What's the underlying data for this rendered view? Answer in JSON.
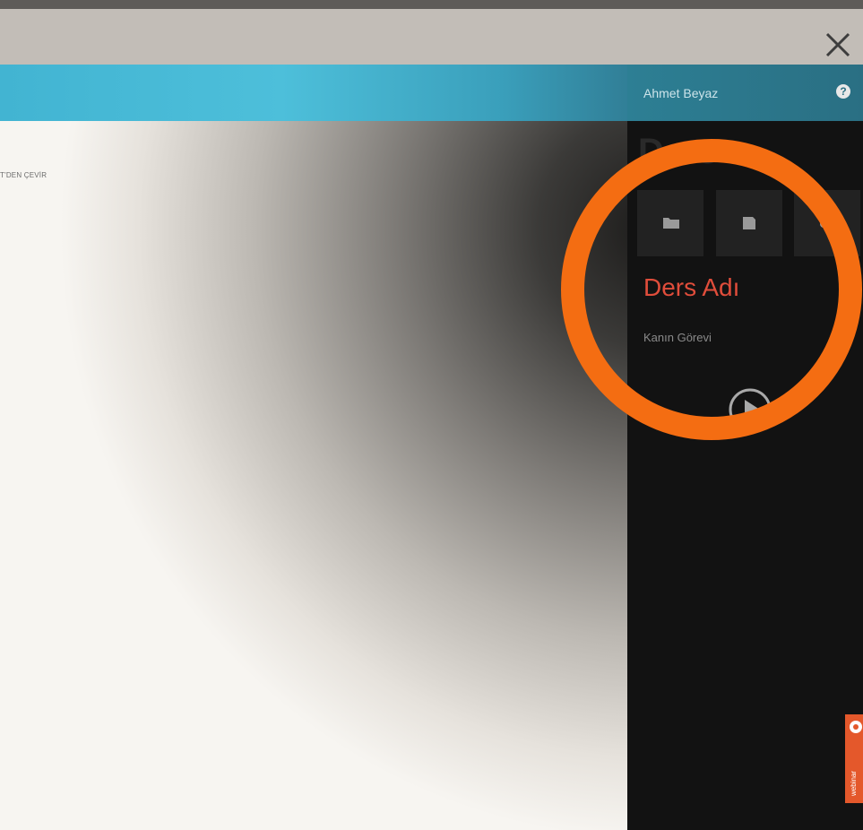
{
  "canvas": {
    "text_fragment": "T'DEN ÇEVİR"
  },
  "panel": {
    "user_name": "Ahmet Beyaz",
    "ghost_title": "Ders",
    "course_title": "Ders Adı",
    "course_subtitle": "Kanın Görevi",
    "tools": [
      "folder-icon",
      "save-icon",
      "cloud-upload-icon"
    ],
    "side_badge_text": "webinar"
  },
  "colors": {
    "header_accent": "#42b4d2",
    "course_title": "#e04d3b",
    "highlight_ring": "#f46d12",
    "panel_bg": "#121212",
    "badge": "#e4582b"
  }
}
